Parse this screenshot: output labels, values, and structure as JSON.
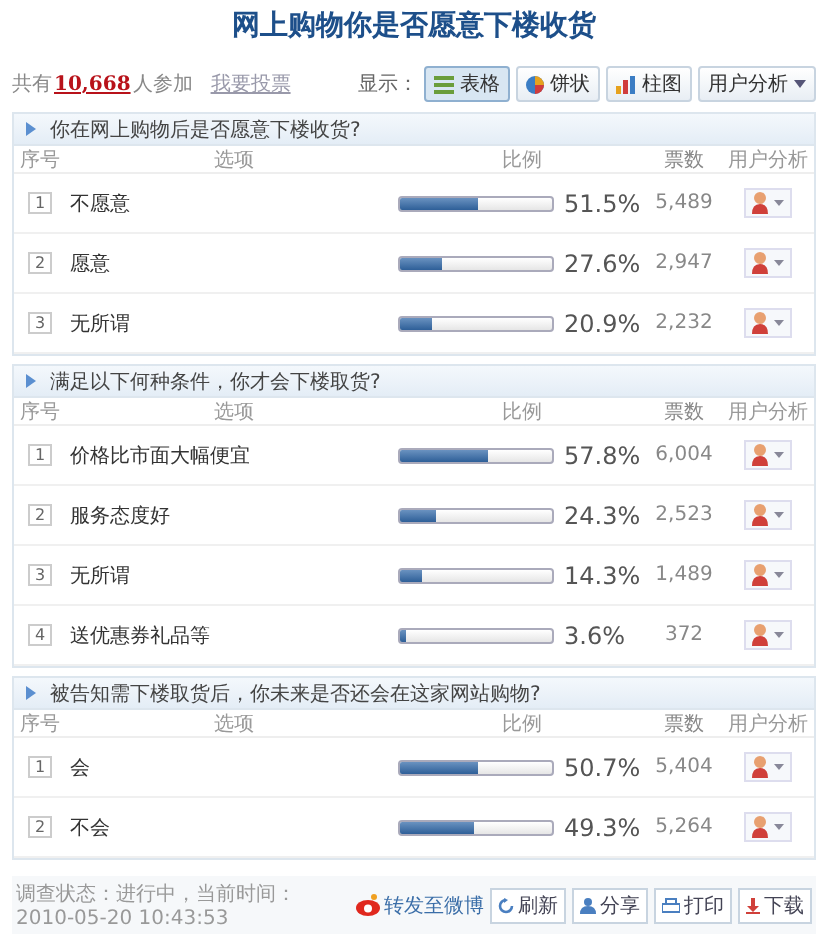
{
  "title": "网上购物你是否愿意下楼收货",
  "summary": {
    "prefix": "共有",
    "count": "10,668",
    "suffix": "人参加",
    "vote_link": "我要投票"
  },
  "display": {
    "label": "显示：",
    "options": [
      {
        "label": "表格",
        "selected": true
      },
      {
        "label": "饼状",
        "selected": false
      },
      {
        "label": "柱图",
        "selected": false
      }
    ],
    "analysis": "用户分析"
  },
  "questions": [
    {
      "title": "你在网上购物后是否愿意下楼收货?",
      "columns": [
        "序号",
        "选项",
        "比例",
        "票数",
        "用户分析"
      ],
      "rows": [
        {
          "index": "1",
          "option": "不愿意",
          "level": 0.515,
          "percent": "51.5%",
          "votes": "5,489"
        },
        {
          "index": "2",
          "option": "愿意",
          "level": 0.276,
          "percent": "27.6%",
          "votes": "2,947"
        },
        {
          "index": "3",
          "option": "无所谓",
          "level": 0.209,
          "percent": "20.9%",
          "votes": "2,232"
        }
      ]
    },
    {
      "title": "满足以下何种条件，你才会下楼取货?",
      "columns": [
        "序号",
        "选项",
        "比例",
        "票数",
        "用户分析"
      ],
      "rows": [
        {
          "index": "1",
          "option": "价格比市面大幅便宜",
          "level": 0.578,
          "percent": "57.8%",
          "votes": "6,004"
        },
        {
          "index": "2",
          "option": "服务态度好",
          "level": 0.243,
          "percent": "24.3%",
          "votes": "2,523"
        },
        {
          "index": "3",
          "option": "无所谓",
          "level": 0.143,
          "percent": "14.3%",
          "votes": "1,489"
        },
        {
          "index": "4",
          "option": "送优惠券礼品等",
          "level": 0.036,
          "percent": "3.6%",
          "votes": "372"
        }
      ]
    },
    {
      "title": "被告知需下楼取货后，你未来是否还会在这家网站购物?",
      "columns": [
        "序号",
        "选项",
        "比例",
        "票数",
        "用户分析"
      ],
      "rows": [
        {
          "index": "1",
          "option": "会",
          "level": 0.507,
          "percent": "50.7%",
          "votes": "5,404"
        },
        {
          "index": "2",
          "option": "不会",
          "level": 0.493,
          "percent": "49.3%",
          "votes": "5,264"
        }
      ]
    }
  ],
  "footer": {
    "status": "调查状态：进行中，当前时间：2010-05-20 10:43:53",
    "weibo": "转发至微博",
    "buttons": [
      "刷新",
      "分享",
      "打印",
      "下载"
    ]
  }
}
